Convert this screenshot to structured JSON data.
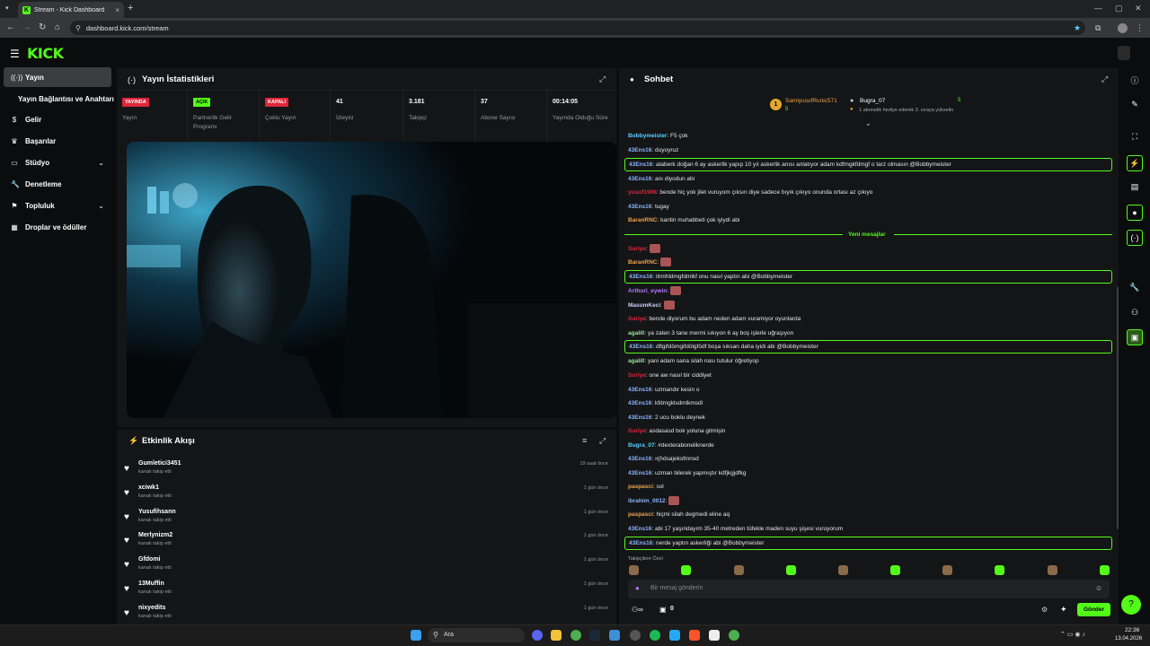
{
  "browser": {
    "tab_title": "Stream - Kick Dashboard",
    "url": "dashboard.kick.com/stream"
  },
  "app": {
    "logo": "KICK"
  },
  "sidebar": {
    "items": [
      {
        "label": "Yayın",
        "icon": "broadcast-icon"
      },
      {
        "label": "Yayın Bağlantısı ve Anahtarı",
        "icon": ""
      },
      {
        "label": "Gelir",
        "icon": "dollar-icon"
      },
      {
        "label": "Başarılar",
        "icon": "trophy-icon"
      },
      {
        "label": "Stüdyo",
        "icon": "studio-icon"
      },
      {
        "label": "Denetleme",
        "icon": "wrench-icon"
      },
      {
        "label": "Topluluk",
        "icon": "community-icon"
      },
      {
        "label": "Droplar ve ödüller",
        "icon": "gift-icon"
      }
    ]
  },
  "stats": {
    "title": "Yayın İstatistikleri",
    "cells": [
      {
        "badge": "YAYINDA",
        "label": "Yayın",
        "color": "#e0263b"
      },
      {
        "badge": "AÇIK",
        "label": "Partnerlik Gelir Programı",
        "color": "#53fc18"
      },
      {
        "badge": "KAPALI",
        "label": "Çoklu Yayın",
        "color": "#e0263b"
      },
      {
        "value": "41",
        "label": "İzleyici"
      },
      {
        "value": "3.181",
        "label": "Takipçi"
      },
      {
        "value": "37",
        "label": "Abone Sayısı"
      },
      {
        "value": "00:14:05",
        "label": "Yayında Olduğu Süre"
      }
    ]
  },
  "activity": {
    "title": "Etkinlik Akışı",
    "items": [
      {
        "name": "Gumletici3451",
        "sub": "kanalı takip etti",
        "time": "19 saat önce"
      },
      {
        "name": "xciwk1",
        "sub": "kanalı takip etti",
        "time": "1 gün önce"
      },
      {
        "name": "Yusufihsann",
        "sub": "kanalı takip etti",
        "time": "1 gün önce"
      },
      {
        "name": "Merlynizm2",
        "sub": "kanalı takip etti",
        "time": "1 gün önce"
      },
      {
        "name": "Gfdomi",
        "sub": "kanalı takip etti",
        "time": "1 gün önce"
      },
      {
        "name": "13Muffin",
        "sub": "kanalı takip etti",
        "time": "1 gün önce"
      },
      {
        "name": "nixyedits",
        "sub": "kanalı takip etti",
        "time": "1 gün önce"
      }
    ]
  },
  "chat": {
    "title": "Sohbet",
    "pinned": {
      "user1": "SamiyusufRunic571",
      "count1": "5",
      "user2": "Bugra_07",
      "count2": "5",
      "note": "1 abonelik hediye ederek 3. sıraya yükselin"
    },
    "new_messages": "Yeni mesajlar",
    "messages": [
      {
        "user": "Bobbymeister",
        "color": "#5ad1ff",
        "text": ": F5 çok",
        "hl": false
      },
      {
        "user": "43Ens16",
        "color": "#8ab4f8",
        "text": ": duyoyruz",
        "hl": false
      },
      {
        "user": "43Ens16",
        "color": "#8ab4f8",
        "text": ": ataberk doğan 6 ay askerlik yapıp 10 yıl askerlik anısı anlatıyor adam kdfmgkfdmgf o tarz olmasın @Bobbymeister",
        "hl": true
      },
      {
        "user": "43Ens16",
        "color": "#8ab4f8",
        "text": ": anı diyodun abi",
        "hl": false
      },
      {
        "user": "yusuf1906",
        "color": "#e0263b",
        "text": ": bende hiç yok jilet vuruyom çıksın diye sadece bıyık çıkıyo onunda ortası az çıkıyo",
        "hl": false
      },
      {
        "user": "43Ens16",
        "color": "#8ab4f8",
        "text": ": tugay",
        "hl": false
      },
      {
        "user": "BaranRNC",
        "color": "#f0a24a",
        "text": ": kantin muhabbeti çok iyiydi abi",
        "hl": false
      },
      {
        "user": "Suriye",
        "color": "#e0263b",
        "text": ":",
        "hl": false
      },
      {
        "user": "BaranRNC",
        "color": "#f0a24a",
        "text": ":",
        "hl": false
      },
      {
        "user": "43Ens16",
        "color": "#8ab4f8",
        "text": ": itrmhldmgfdmlkf onu nasıl yaptın abi @Bobbymeister",
        "hl": true
      },
      {
        "user": "Arthuri_eywin",
        "color": "#b07aff",
        "text": ":",
        "hl": false
      },
      {
        "user": "MasumKeci",
        "color": "#cfcfff",
        "text": ":",
        "hl": false
      },
      {
        "user": "Suriye",
        "color": "#e0263b",
        "text": ": bende diyorum bu adam neden adam vuramiyor oyunlarda",
        "hl": false
      },
      {
        "user": "agali0",
        "color": "#9be29b",
        "text": ": ya zaten 3 tane mermi sıkıyon 6 ay boş işlerle uğraşıyon",
        "hl": false
      },
      {
        "user": "43Ens16",
        "color": "#8ab4f8",
        "text": ": dflgifdömgifdölgfödf boşa sıksan daha iyidi abi @Bobbymeister",
        "hl": true
      },
      {
        "user": "agali0",
        "color": "#9be29b",
        "text": ": yani adam sana silah nası tutulur öğretiyop",
        "hl": false
      },
      {
        "user": "Suriye",
        "color": "#e0263b",
        "text": ": one aw nasıl bir ciddiyet",
        "hl": false
      },
      {
        "user": "43Ens16",
        "color": "#8ab4f8",
        "text": ": uzmandır kesin o",
        "hl": false
      },
      {
        "user": "43Ens16",
        "color": "#8ab4f8",
        "text": ": kfdmgklsdmlkmsdl",
        "hl": false
      },
      {
        "user": "43Ens16",
        "color": "#8ab4f8",
        "text": ": 2 ucu boklu deynek",
        "hl": false
      },
      {
        "user": "Suriye",
        "color": "#e0263b",
        "text": ": asdasasd bok yoluna gitmişin",
        "hl": false
      },
      {
        "user": "Bugra_07",
        "color": "#5ad1ff",
        "text": ": #dexteraboneliknerde",
        "hl": false
      },
      {
        "user": "43Ens16",
        "color": "#8ab4f8",
        "text": ": ırjfıdsajeksfmnsd",
        "hl": false
      },
      {
        "user": "43Ens16",
        "color": "#8ab4f8",
        "text": ": uzman bilerek yapmıştır kdfjkgjdfkg",
        "hl": false
      },
      {
        "user": "paspasci",
        "color": "#f0a24a",
        "text": ": sol",
        "hl": false
      },
      {
        "user": "ibrahim_0012",
        "color": "#8ab4f8",
        "text": ":",
        "hl": false
      },
      {
        "user": "paspasci",
        "color": "#f0a24a",
        "text": ": hiçmi silah degmedi eline aq",
        "hl": false
      },
      {
        "user": "43Ens16",
        "color": "#8ab4f8",
        "text": ": abi 17 yaşındayım 35-40 metreden tüfekle maden suyu şişesi vuruyorum",
        "hl": false
      },
      {
        "user": "43Ens16",
        "color": "#8ab4f8",
        "text": ": nerde yaptın askerliği abi @Bobbymeister",
        "hl": true
      }
    ],
    "emote_section": "Takipçilere Özel",
    "input_placeholder": "Bir mesaj gönderin",
    "points": "0",
    "send_label": "Gönder"
  },
  "taskbar": {
    "search": "Ara",
    "time": "22:36",
    "date": "13.04.2026"
  },
  "colors": {
    "accent": "#53fc18",
    "live": "#e0263b"
  }
}
